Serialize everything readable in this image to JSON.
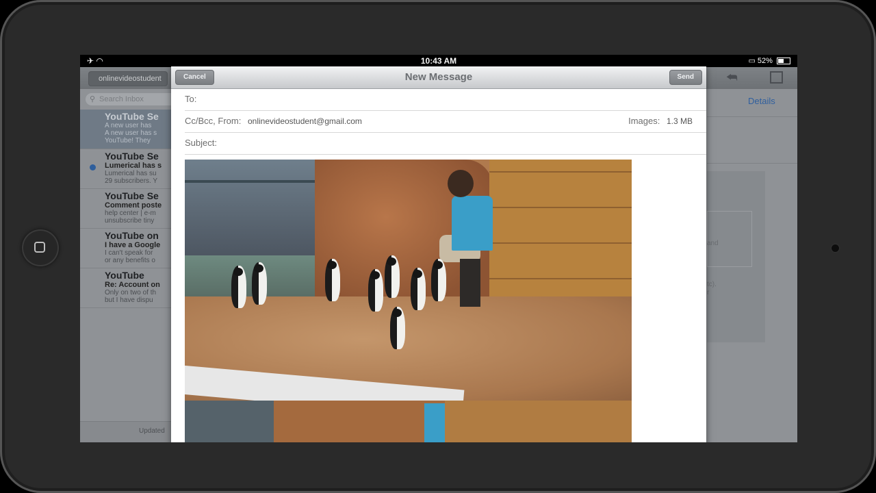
{
  "status_bar": {
    "time": "10:43 AM",
    "battery": "52%"
  },
  "background_app": {
    "back_button": "onlinevideostudent",
    "search_placeholder": "Search Inbox",
    "details_link": "Details",
    "updated_text": "Updated",
    "messages": [
      {
        "from": "YouTube Se",
        "subject": "A new user has",
        "preview": "A new user has s",
        "preview2": "YouTube! They",
        "selected": true,
        "unread": false
      },
      {
        "from": "YouTube Se",
        "subject": "Lumerical has s",
        "preview": "Lumerical has su",
        "preview2": "29 subscribers. Y",
        "selected": false,
        "unread": true
      },
      {
        "from": "YouTube Se",
        "subject": "Comment poste",
        "preview": "help center | e-m",
        "preview2": "unsubscribe tiny",
        "selected": false,
        "unread": false
      },
      {
        "from": "YouTube on",
        "subject": "I have a Google",
        "preview": "I can't speak for",
        "preview2": "or any benefits o",
        "selected": false,
        "unread": false
      },
      {
        "from": "YouTube",
        "subject": "Re: Account on",
        "preview": "Only on two of th",
        "preview2": "but I have dispu",
        "selected": false,
        "unread": false
      }
    ],
    "ghost_text": [
      "and",
      "tc).",
      "r"
    ]
  },
  "compose": {
    "title": "New Message",
    "cancel_label": "Cancel",
    "send_label": "Send",
    "to_label": "To:",
    "cc_label": "Cc/Bcc, From:",
    "from_value": "onlinevideostudent@gmail.com",
    "images_label": "Images:",
    "images_size": "1.3 MB",
    "subject_label": "Subject:"
  },
  "colors": {
    "accent_link": "#2f5f9e",
    "unread_dot": "#2e5e9c",
    "staff_shirt": "#3a9ec8"
  }
}
